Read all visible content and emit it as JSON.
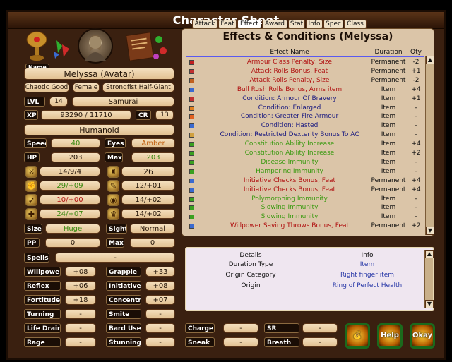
{
  "window": {
    "title": "Character Sheet"
  },
  "character": {
    "name_label": "Name",
    "name": "Melyssa (Avatar)",
    "alignment": "Chaotic Good",
    "gender": "Female",
    "race": "Strongfist Half-Giant",
    "lvl_label": "LVL",
    "lvl": "14",
    "class": "Samurai",
    "xp_label": "XP",
    "xp": "93290 / 11710",
    "cr_label": "CR",
    "cr": "13",
    "type": "Humanoid",
    "speed_label": "Speed",
    "speed": "40",
    "eyes_label": "Eyes",
    "eyes": "Amber",
    "hp_label": "HP",
    "hp": "203",
    "max_label": "Max",
    "max": "203",
    "stat_a": "14/9/4",
    "stat_b": "26",
    "str": "29/+09",
    "int": "12/+01",
    "dex": "10/+00",
    "wis": "14/+02",
    "con": "24/+07",
    "cha": "14/+02",
    "size_label": "Size",
    "size": "Huge",
    "sight_label": "Sight",
    "sight": "Normal",
    "pp_label": "PP",
    "pp": "0",
    "ppmax_label": "Max",
    "ppmax": "0",
    "spells_label": "Spells",
    "spells": "-",
    "willpower_label": "Willpower",
    "willpower": "+08",
    "grapple_label": "Grapple",
    "grapple": "+33",
    "reflex_label": "Reflex",
    "reflex": "+06",
    "initiative_label": "Initiative",
    "initiative": "+08",
    "fortitude_label": "Fortitude",
    "fortitude": "+18",
    "concentr_label": "Concentr.",
    "concentr": "+07",
    "turning_label": "Turning",
    "turning": "-",
    "smite_label": "Smite",
    "smite": "-",
    "lifedrain_label": "Life Drain",
    "lifedrain": "-",
    "bardsongs_label": "Bard Uses",
    "bardsongs": "-",
    "rage_label": "Rage",
    "rage": "-",
    "stunning_label": "Stunning",
    "stunning": "-",
    "charge_label": "Charge",
    "charge": "-",
    "sr_label": "SR",
    "sr": "-",
    "sneak_label": "Sneak",
    "sneak": "-",
    "breath_label": "Breath",
    "breath": "-"
  },
  "tabs": [
    "Attack",
    "Feat",
    "Effect",
    "Award",
    "Stat",
    "Info",
    "Spec",
    "Class"
  ],
  "effects": {
    "title": "Effects & Conditions (Melyssa)",
    "col_name": "Effect Name",
    "col_duration": "Duration",
    "col_qty": "Qty",
    "rows": [
      {
        "name": "Armour Class Penalty, Size",
        "duration": "Permanent",
        "qty": "-2",
        "color": "#b01010",
        "icon": "#c02020"
      },
      {
        "name": "Attack Rolls Bonus, Feat",
        "duration": "Permanent",
        "qty": "+1",
        "color": "#b01010",
        "icon": "#c03030"
      },
      {
        "name": "Attack Rolls Penalty, Size",
        "duration": "Permanent",
        "qty": "-2",
        "color": "#b01010",
        "icon": "#c06020"
      },
      {
        "name": "Bull Rush Rolls Bonus, Arms item",
        "duration": "Item",
        "qty": "+4",
        "color": "#b01010",
        "icon": "#3a6ad0"
      },
      {
        "name": "Condition: Armour Of Bravery",
        "duration": "Item",
        "qty": "+1",
        "color": "#1a1a80",
        "icon": "#c03030"
      },
      {
        "name": "Condition: Enlarged",
        "duration": "Item",
        "qty": "-",
        "color": "#1a1a80",
        "icon": "#e08020"
      },
      {
        "name": "Condition: Greater Fire Armour",
        "duration": "Item",
        "qty": "-",
        "color": "#1a1a80",
        "icon": "#e06020"
      },
      {
        "name": "Condition: Hasted",
        "duration": "Item",
        "qty": "-",
        "color": "#1a1a80",
        "icon": "#3a6ad0"
      },
      {
        "name": "Condition: Restricted Dexterity Bonus To AC",
        "duration": "Item",
        "qty": "-",
        "color": "#1a1a80",
        "icon": "#d0a040"
      },
      {
        "name": "Constitution Ability Increase",
        "duration": "Item",
        "qty": "+4",
        "color": "#3a9a10",
        "icon": "#3aa020"
      },
      {
        "name": "Constitution Ability Increase",
        "duration": "Item",
        "qty": "+2",
        "color": "#3a9a10",
        "icon": "#3aa020"
      },
      {
        "name": "Disease Immunity",
        "duration": "Item",
        "qty": "-",
        "color": "#3a9a10",
        "icon": "#3aa020"
      },
      {
        "name": "Hampering Immunity",
        "duration": "Item",
        "qty": "-",
        "color": "#3a9a10",
        "icon": "#3aa020"
      },
      {
        "name": "Initiative Checks Bonus, Feat",
        "duration": "Permanent",
        "qty": "+4",
        "color": "#b01010",
        "icon": "#3a6ad0"
      },
      {
        "name": "Initiative Checks Bonus, Feat",
        "duration": "Permanent",
        "qty": "+4",
        "color": "#b01010",
        "icon": "#3a6ad0"
      },
      {
        "name": "Polymorphing Immunity",
        "duration": "Item",
        "qty": "-",
        "color": "#3a9a10",
        "icon": "#3aa020"
      },
      {
        "name": "Slowing Immunity",
        "duration": "Item",
        "qty": "-",
        "color": "#3a9a10",
        "icon": "#3aa020"
      },
      {
        "name": "Slowing Immunity",
        "duration": "Item",
        "qty": "-",
        "color": "#3a9a10",
        "icon": "#3aa020"
      },
      {
        "name": "Willpower Saving Throws Bonus, Feat",
        "duration": "Permanent",
        "qty": "+2",
        "color": "#b01010",
        "icon": "#3a6ad0"
      }
    ]
  },
  "details": {
    "col_details": "Details",
    "col_info": "Info",
    "rows": [
      {
        "k": "Duration Type",
        "v": "Item"
      },
      {
        "k": "Origin Category",
        "v": "Right finger item"
      },
      {
        "k": "Origin",
        "v": "Ring of Perfect Health"
      }
    ]
  },
  "buttons": {
    "inventory": "bag",
    "help": "Help",
    "okay": "Okay"
  }
}
